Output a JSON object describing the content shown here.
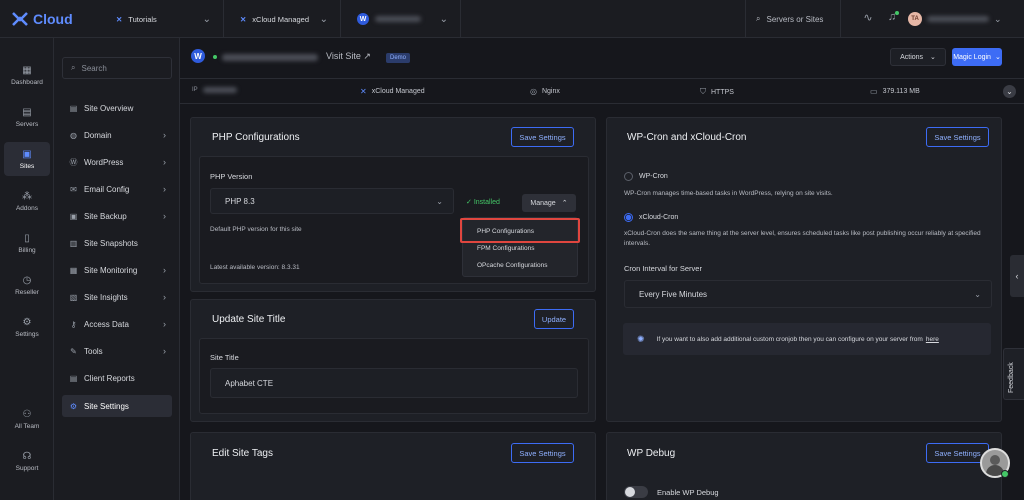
{
  "brand": {
    "name": "Cloud"
  },
  "topbar": {
    "crumbs": [
      {
        "label": "Tutorials",
        "icon": "xcloud-icon"
      },
      {
        "label": "xCloud Managed",
        "icon": "xcloud-icon"
      },
      {
        "label": "",
        "icon": "wordpress-icon"
      }
    ],
    "search_label": "Servers or Sites",
    "user_initials": "TA"
  },
  "leftnav": [
    {
      "label": "Dashboard",
      "icon": "dashboard-icon"
    },
    {
      "label": "Servers",
      "icon": "servers-icon"
    },
    {
      "label": "Sites",
      "icon": "sites-icon",
      "active": true
    },
    {
      "label": "Addons",
      "icon": "addons-icon"
    },
    {
      "label": "Billing",
      "icon": "billing-icon"
    },
    {
      "label": "Reseller",
      "icon": "reseller-icon"
    },
    {
      "label": "Settings",
      "icon": "settings-icon"
    },
    {
      "label": "All Team",
      "icon": "team-icon"
    },
    {
      "label": "Support",
      "icon": "support-icon"
    }
  ],
  "sidenav": {
    "search_placeholder": "Search",
    "items": [
      {
        "label": "Site Overview",
        "has_arrow": false
      },
      {
        "label": "Domain",
        "has_arrow": true
      },
      {
        "label": "WordPress",
        "has_arrow": true
      },
      {
        "label": "Email Config",
        "has_arrow": true
      },
      {
        "label": "Site Backup",
        "has_arrow": true
      },
      {
        "label": "Site Snapshots",
        "has_arrow": false
      },
      {
        "label": "Site Monitoring",
        "has_arrow": true
      },
      {
        "label": "Site Insights",
        "has_arrow": true
      },
      {
        "label": "Access Data",
        "has_arrow": true
      },
      {
        "label": "Tools",
        "has_arrow": true
      },
      {
        "label": "Client Reports",
        "has_arrow": false
      },
      {
        "label": "Site Settings",
        "has_arrow": false,
        "active": true
      }
    ]
  },
  "site_header": {
    "visit_label": "Visit Site ↗",
    "badge": "Demo",
    "actions_label": "Actions",
    "magic_login_label": "Magic Login"
  },
  "infobar": {
    "ip_prefix": "IP",
    "stack": "xCloud Managed",
    "server": "Nginx",
    "protocol": "HTTPS",
    "disk": "379.113 MB"
  },
  "php_card": {
    "title": "PHP Configurations",
    "save_label": "Save Settings",
    "version_label": "PHP Version",
    "version_value": "PHP 8.3",
    "installed_label": "Installed",
    "manage_label": "Manage",
    "default_note": "Default PHP version for this site",
    "latest_note": "Latest available version: 8.3.31",
    "menu": [
      "PHP Configurations",
      "FPM Configurations",
      "OPcache Configurations"
    ]
  },
  "title_card": {
    "title": "Update Site Title",
    "update_label": "Update",
    "field_label": "Site Title",
    "field_value": "Aphabet CTE"
  },
  "tags_card": {
    "title": "Edit Site Tags",
    "save_label": "Save Settings"
  },
  "cron_card": {
    "title": "WP-Cron and xCloud-Cron",
    "save_label": "Save Settings",
    "wp_cron_label": "WP-Cron",
    "wp_cron_desc": "WP-Cron manages time-based tasks in WordPress, relying on site visits.",
    "xcloud_cron_label": "xCloud-Cron",
    "xcloud_cron_desc": "xCloud-Cron does the same thing at the server level, ensures scheduled tasks like post publishing occur reliably at specified intervals.",
    "interval_label": "Cron Interval for Server",
    "interval_value": "Every Five Minutes",
    "info_text": "If you want to also add additional custom cronjob then you can configure on your server from",
    "info_link": "here"
  },
  "debug_card": {
    "title": "WP Debug",
    "save_label": "Save Settings",
    "toggle_label": "Enable WP Debug"
  },
  "feedback_label": "Feedback",
  "colors": {
    "accent": "#3d6cf5",
    "success": "#44c767",
    "highlight": "#e0463f",
    "background": "#16171c"
  }
}
